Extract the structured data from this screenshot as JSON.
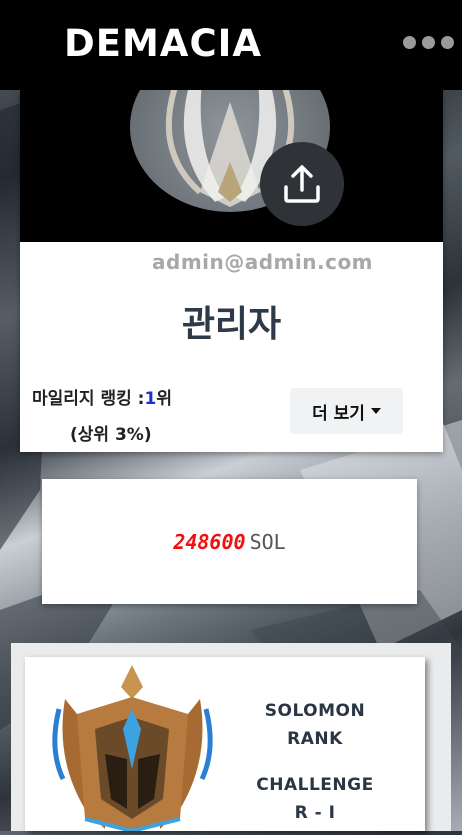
{
  "header": {
    "brand": "DEMACIA",
    "menu_icon": "more-horizontal-icon"
  },
  "profile": {
    "email": "admin@admin.com",
    "nickname": "관리자",
    "mileage_rank_label": "마일리지 랭킹 :",
    "mileage_rank_value": "1",
    "mileage_rank_suffix": "위",
    "top_percent": "(상위 3%)",
    "more_button": "더 보기",
    "upload_icon": "upload-icon"
  },
  "points": {
    "value": "248600",
    "unit": "SOL"
  },
  "rank": {
    "title_line1": "SOLOMON",
    "title_line2": "RANK",
    "tier_line1": "CHALLENGE",
    "tier_line2": "R - I"
  },
  "colors": {
    "header_bg": "#000000",
    "points": "#f01010",
    "rank_highlight": "#1b2fe0",
    "text_dark": "#2f3a48"
  }
}
